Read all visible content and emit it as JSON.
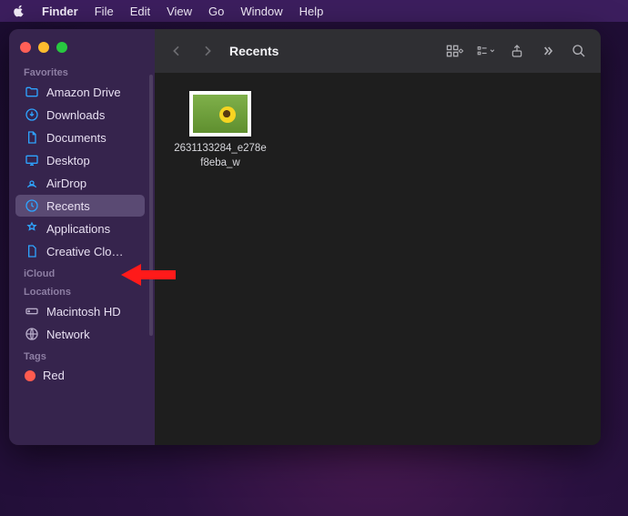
{
  "menubar": {
    "app_name": "Finder",
    "items": [
      "File",
      "Edit",
      "View",
      "Go",
      "Window",
      "Help"
    ]
  },
  "window": {
    "title": "Recents"
  },
  "sidebar": {
    "sections": [
      {
        "header": "Favorites",
        "items": [
          {
            "icon": "folder-icon",
            "label": "Amazon Drive"
          },
          {
            "icon": "download-icon",
            "label": "Downloads"
          },
          {
            "icon": "document-icon",
            "label": "Documents"
          },
          {
            "icon": "desktop-icon",
            "label": "Desktop"
          },
          {
            "icon": "airdrop-icon",
            "label": "AirDrop"
          },
          {
            "icon": "clock-icon",
            "label": "Recents",
            "selected": true
          },
          {
            "icon": "apps-icon",
            "label": "Applications",
            "pointer": true
          },
          {
            "icon": "file-icon",
            "label": "Creative Clo…"
          }
        ]
      },
      {
        "header": "iCloud",
        "items": []
      },
      {
        "header": "Locations",
        "items": [
          {
            "icon": "disk-icon",
            "label": "Macintosh HD",
            "gray": true
          },
          {
            "icon": "globe-icon",
            "label": "Network",
            "gray": true
          }
        ]
      },
      {
        "header": "Tags",
        "items": [
          {
            "icon": "tag-dot",
            "color": "#ff5b4f",
            "label": "Red"
          }
        ]
      }
    ]
  },
  "files": [
    {
      "name": "2631133284_e278ef8eba_w"
    }
  ]
}
